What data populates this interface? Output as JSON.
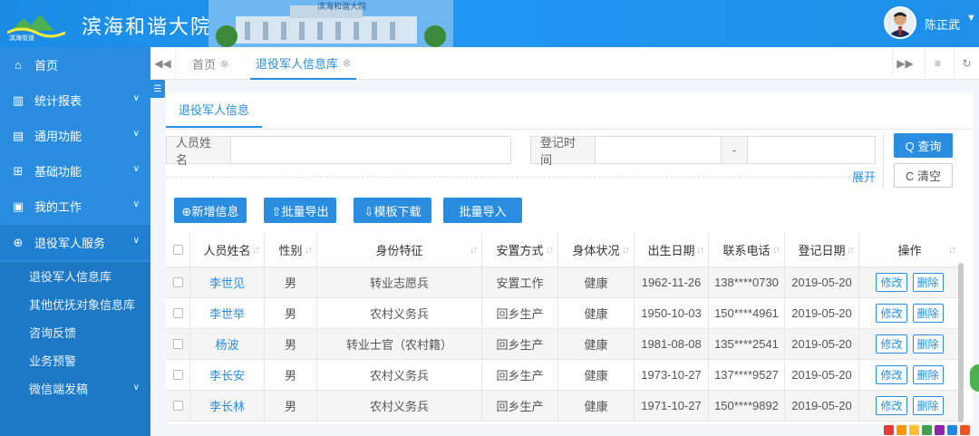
{
  "header": {
    "site_title": "滨海和谐大院",
    "logo_text": "滨海街道",
    "banner_text": "滨海和谐大院",
    "user_name": "陈正武",
    "caret": "▼"
  },
  "sidebar": {
    "items": [
      {
        "label": "首页",
        "icon": "home-icon",
        "glyph": "⌂"
      },
      {
        "label": "统计报表",
        "icon": "bar-chart-icon",
        "glyph": "▥"
      },
      {
        "label": "通用功能",
        "icon": "building-icon",
        "glyph": "▤"
      },
      {
        "label": "基础功能",
        "icon": "grid-icon",
        "glyph": "⊞"
      },
      {
        "label": "我的工作",
        "icon": "briefcase-icon",
        "glyph": "▣"
      },
      {
        "label": "退役军人服务",
        "icon": "crosshair-icon",
        "glyph": "⊕"
      }
    ],
    "chevron": "∨",
    "sub_items": [
      {
        "label": "退役军人信息库"
      },
      {
        "label": "其他优抚对象信息库"
      },
      {
        "label": "咨询反馈"
      },
      {
        "label": "业务预警"
      },
      {
        "label": "微信端发稿"
      }
    ]
  },
  "tabs": {
    "nav_prev": "◀◀",
    "items": [
      {
        "label": "首页",
        "close": "⊗"
      },
      {
        "label": "退役军人信息库",
        "close": "⊗"
      }
    ],
    "nav_next": "▶▶",
    "menu": "≡",
    "refresh": "↻"
  },
  "panel": {
    "tab_label": "退役军人信息",
    "search": {
      "name_label": "人员姓名",
      "name_value": "",
      "date_label": "登记时间",
      "date_from": "",
      "date_sep": "-",
      "date_to": "",
      "expand": "展开",
      "query": "Q 查询",
      "clear": "C 清空"
    },
    "actions": {
      "add": "⊕新增信息",
      "export": "⇧批量导出",
      "template": "⇩模板下载",
      "import": "批量导入"
    }
  },
  "table": {
    "columns": [
      "人员姓名",
      "性别",
      "身份特征",
      "安置方式",
      "身体状况",
      "出生日期",
      "联系电话",
      "登记日期",
      "操作"
    ],
    "sort_glyph": "↓↑",
    "edit_label": "修改",
    "delete_label": "删除",
    "rows": [
      {
        "name": "李世见",
        "gender": "男",
        "identity": "转业志愿兵",
        "placement": "安置工作",
        "health": "健康",
        "birth": "1962-11-26",
        "phone": "138****0730",
        "reg": "2019-05-20"
      },
      {
        "name": "李世举",
        "gender": "男",
        "identity": "农村义务兵",
        "placement": "回乡生产",
        "health": "健康",
        "birth": "1950-10-03",
        "phone": "150****4961",
        "reg": "2019-05-20"
      },
      {
        "name": "杨波",
        "gender": "男",
        "identity": "转业士官（农村籍）",
        "placement": "回乡生产",
        "health": "健康",
        "birth": "1981-08-08",
        "phone": "135****2541",
        "reg": "2019-05-20"
      },
      {
        "name": "李长安",
        "gender": "男",
        "identity": "农村义务兵",
        "placement": "回乡生产",
        "health": "健康",
        "birth": "1973-10-27",
        "phone": "137****9527",
        "reg": "2019-05-20"
      },
      {
        "name": "李长林",
        "gender": "男",
        "identity": "农村义务兵",
        "placement": "回乡生产",
        "health": "健康",
        "birth": "1971-10-27",
        "phone": "150****9892",
        "reg": "2019-05-20"
      }
    ]
  },
  "colors": {
    "primary": "#2a8de0",
    "sidebar": "#2a8de0",
    "sub_panel": "#1d78c5"
  }
}
